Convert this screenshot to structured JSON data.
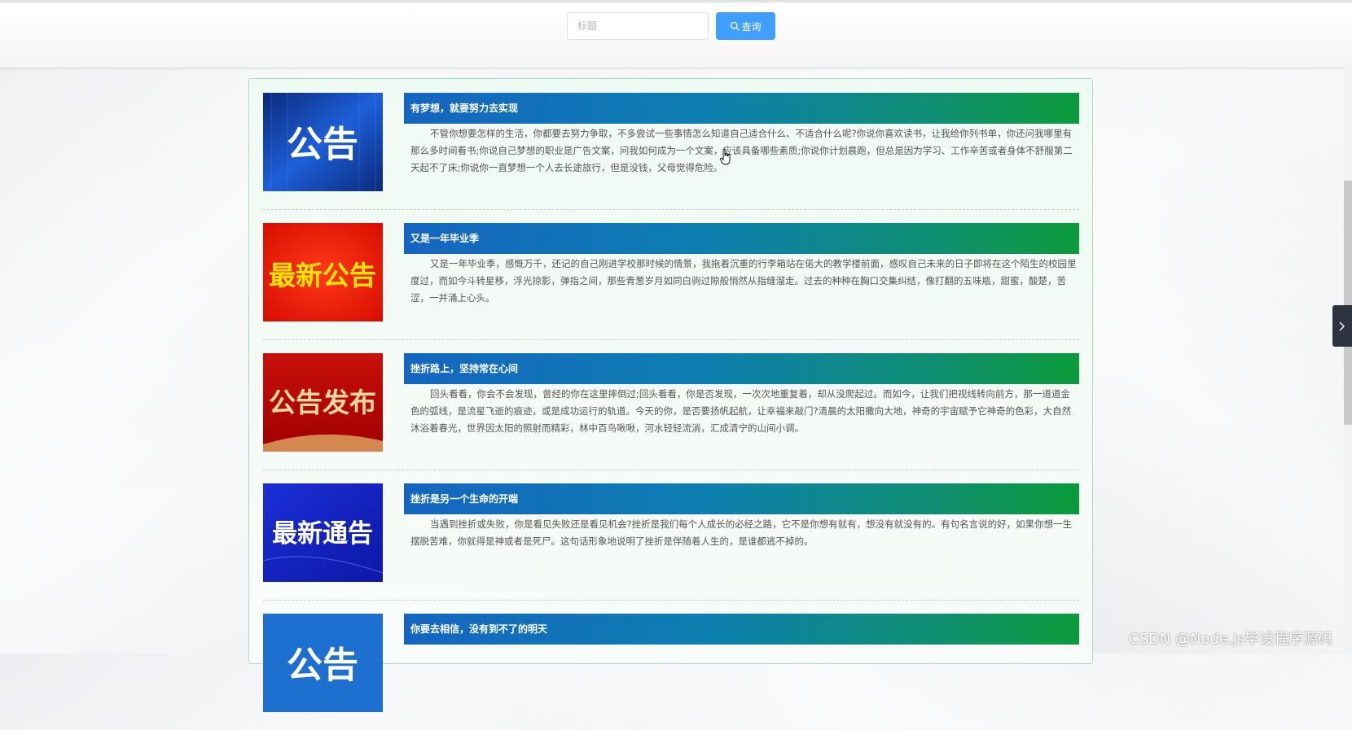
{
  "search": {
    "placeholder": "标题",
    "button_label": "查询"
  },
  "news": [
    {
      "title": "有梦想，就要努力去实现",
      "image_text": "公告",
      "content": "不管你想要怎样的生活，你都要去努力争取，不多尝试一些事情怎么知道自己适合什么、不适合什么呢?你说你喜欢读书，让我给你列书单，你还问我哪里有那么多时间看书;你说自己梦想的职业是广告文案，问我如何成为一个文案，应该具备哪些素质;你说你计划晨跑，但总是因为学习、工作辛苦或者身体不舒服第二天起不了床;你说你一直梦想一个人去长途旅行，但是没钱，父母觉得危险。"
    },
    {
      "title": "又是一年毕业季",
      "image_text": "最新公告",
      "content": "又是一年毕业季，感慨万千，还记的自己刚进学校那时候的情景，我拖着沉重的行李箱站在偌大的教学楼前面，感叹自己未来的日子即将在这个陌生的校园里度过，而如今斗转星移，浮光掠影，弹指之间，那些青葱岁月如同白驹过隙般悄然从指缝溜走。过去的种种在胸口交集纠结，像打翻的五味瓶，甜蜜，酸楚，苦涩，一并涌上心头。"
    },
    {
      "title": "挫折路上，坚持常在心间",
      "image_text": "公告发布",
      "content": "回头看看，你会不会发现，曾经的你在这里摔倒过;回头看看，你是否发现，一次次地重复着，却从没爬起过。而如今，让我们把视线转向前方，那一道道金色的弧线，是流星飞逝的痕迹，或是成功运行的轨道。今天的你，是否要扬帆起航，让幸福来敲门?清晨的太阳撒向大地，神奇的宇宙赋予它神奇的色彩，大自然沐浴着春光，世界因太阳的照射而精彩，林中百鸟啾啾，河水轻轻流淌，汇成清宁的山间小调。"
    },
    {
      "title": "挫折是另一个生命的开端",
      "image_text": "最新通告",
      "content": "当遇到挫折或失败，你是看见失败还是看见机会?挫折是我们每个人成长的必经之路，它不是你想有就有，想没有就没有的。有句名言说的好，如果你想一生摆脱苦难，你就得是神或者是死尸。这句话形象地说明了挫折是伴随着人生的，是谁都逃不掉的。"
    },
    {
      "title": "你要去相信，没有到不了的明天",
      "image_text": "公告",
      "content": ""
    }
  ],
  "watermark": "CSDN @Node.js毕设程序源码",
  "colors": {
    "button": "#409eff",
    "title_bar_start": "#1565c0",
    "title_bar_end": "#0c9b3a"
  }
}
